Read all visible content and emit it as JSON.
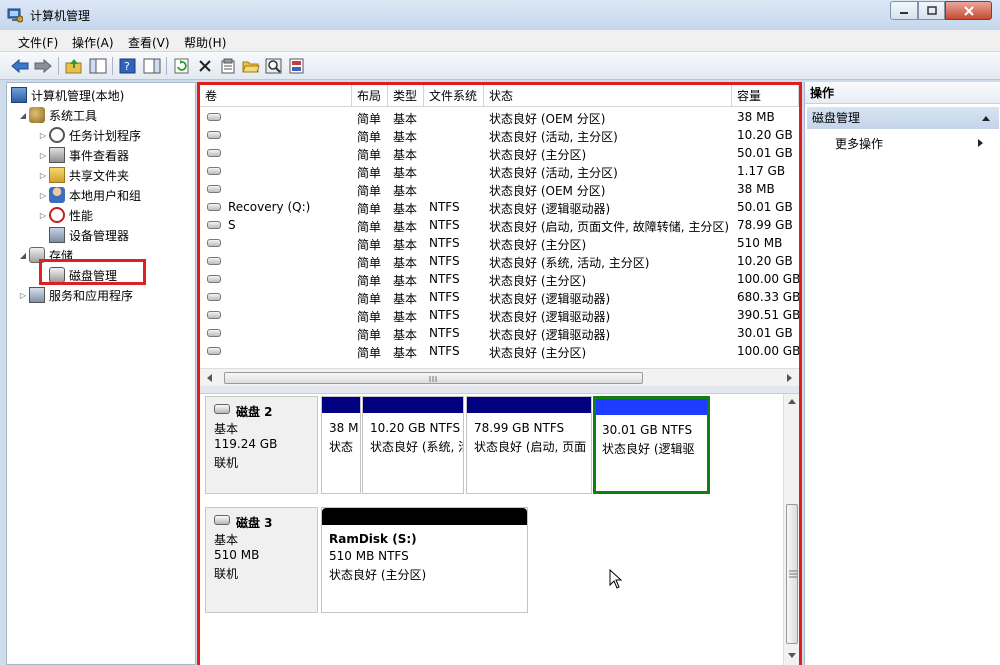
{
  "window": {
    "title": "计算机管理"
  },
  "menu": [
    "文件(F)",
    "操作(A)",
    "查看(V)",
    "帮助(H)"
  ],
  "toolbar_icons": [
    "back-arrow-icon",
    "forward-arrow-icon",
    "up-folder-icon",
    "show-hide-tree-icon",
    "help-icon",
    "properties-pane-icon",
    "refresh-icon",
    "delete-icon",
    "properties-icon",
    "open-folder-icon",
    "search-icon",
    "help-topics-icon"
  ],
  "nav": {
    "root": "计算机管理(本地)",
    "system_tools": "系统工具",
    "task_scheduler": "任务计划程序",
    "event_viewer": "事件查看器",
    "shared_folders": "共享文件夹",
    "local_users": "本地用户和组",
    "performance": "性能",
    "device_manager": "设备管理器",
    "storage": "存储",
    "disk_management": "磁盘管理",
    "services_apps": "服务和应用程序"
  },
  "volumes": {
    "headers": [
      "卷",
      "布局",
      "类型",
      "文件系统",
      "状态",
      "容量"
    ],
    "rows": [
      [
        "",
        "简单",
        "基本",
        "",
        "状态良好 (OEM 分区)",
        "38 MB"
      ],
      [
        "",
        "简单",
        "基本",
        "",
        "状态良好 (活动, 主分区)",
        "10.20 GB"
      ],
      [
        "",
        "简单",
        "基本",
        "",
        "状态良好 (主分区)",
        "50.01 GB"
      ],
      [
        "",
        "简单",
        "基本",
        "",
        "状态良好 (活动, 主分区)",
        "1.17 GB"
      ],
      [
        "",
        "简单",
        "基本",
        "",
        "状态良好 (OEM 分区)",
        "38 MB"
      ],
      [
        "Recovery (Q:)",
        "简单",
        "基本",
        "NTFS",
        "状态良好 (逻辑驱动器)",
        "50.01 GB"
      ],
      [
        "S",
        "简单",
        "基本",
        "NTFS",
        "状态良好 (启动, 页面文件, 故障转储, 主分区)",
        "78.99 GB"
      ],
      [
        "",
        "简单",
        "基本",
        "NTFS",
        "状态良好 (主分区)",
        "510 MB"
      ],
      [
        "",
        "简单",
        "基本",
        "NTFS",
        "状态良好 (系统, 活动, 主分区)",
        "10.20 GB"
      ],
      [
        "",
        "简单",
        "基本",
        "NTFS",
        "状态良好 (主分区)",
        "100.00 GB"
      ],
      [
        "",
        "简单",
        "基本",
        "NTFS",
        "状态良好 (逻辑驱动器)",
        "680.33 GB"
      ],
      [
        "",
        "简单",
        "基本",
        "NTFS",
        "状态良好 (逻辑驱动器)",
        "390.51 GB"
      ],
      [
        "",
        "简单",
        "基本",
        "NTFS",
        "状态良好 (逻辑驱动器)",
        "30.01 GB"
      ],
      [
        "",
        "简单",
        "基本",
        "NTFS",
        "状态良好 (主分区)",
        "100.00 GB"
      ]
    ]
  },
  "disks": {
    "disk2": {
      "name": "磁盘 2",
      "type": "基本",
      "size": "119.24 GB",
      "state": "联机",
      "partitions": [
        {
          "line1": "38 M",
          "line2": "状态"
        },
        {
          "line1": "10.20 GB NTFS",
          "line2": "状态良好 (系统, 活"
        },
        {
          "line1": "78.99 GB NTFS",
          "line2": "状态良好 (启动, 页面"
        },
        {
          "line1": "30.01 GB NTFS",
          "line2": "状态良好 (逻辑驱"
        }
      ]
    },
    "disk3": {
      "name": "磁盘 3",
      "type": "基本",
      "size": "510 MB",
      "state": "联机",
      "partition": {
        "title": "RamDisk  (S:)",
        "line1": "510 MB NTFS",
        "line2": "状态良好 (主分区)"
      }
    }
  },
  "actions": {
    "title": "操作",
    "section": "磁盘管理",
    "more": "更多操作"
  },
  "colors": {
    "primary_partition": "#000080",
    "logical_partition": "#1e3cff",
    "highlight_red": "#e11c1c",
    "selected_green": "#108010"
  }
}
